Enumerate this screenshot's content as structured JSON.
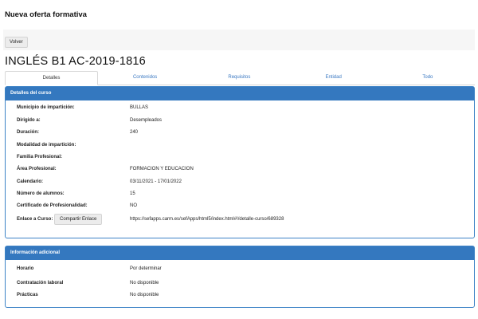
{
  "page": {
    "title": "Nueva oferta formativa",
    "back_label": "Volver",
    "course_title": "INGLÉS B1 AC-2019-1816"
  },
  "tabs": [
    {
      "label": "Detalles",
      "active": true
    },
    {
      "label": "Contenidos",
      "active": false
    },
    {
      "label": "Requisitos",
      "active": false
    },
    {
      "label": "Entidad",
      "active": false
    },
    {
      "label": "Todo",
      "active": false
    }
  ],
  "details": {
    "heading": "Detalles del curso",
    "rows": [
      {
        "label": "Municipio de impartición:",
        "value": "BULLAS"
      },
      {
        "label": "Dirigido a:",
        "value": "Desempleados"
      },
      {
        "label": "Duración:",
        "value": "240"
      },
      {
        "label": "Modalidad de impartición:",
        "value": ""
      },
      {
        "label": "Familia Profesional:",
        "value": ""
      },
      {
        "label": "Área Profesional:",
        "value": "FORMACION Y EDUCACION"
      },
      {
        "label": "Calendario:",
        "value": "03/11/2021 - 17/01/2022"
      },
      {
        "label": "Número de alumnos:",
        "value": "15"
      },
      {
        "label": "Certificado de Profesionalidad:",
        "value": "NO"
      },
      {
        "label": "Enlace a Curso:",
        "value": "https://sefapps.carm.es/sefApps/html5/index.html#!/detalle-curso/689328"
      }
    ],
    "share_label": "Compartir Enlace"
  },
  "extra": {
    "heading": "Información adicional",
    "rows": [
      {
        "label": "Horario",
        "value": "Por determinar"
      },
      {
        "label": "Contratación laboral",
        "value": "No disponible"
      },
      {
        "label": "Prácticas",
        "value": "No disponible"
      }
    ]
  },
  "colors": {
    "panel_header": "#3478bf",
    "tab_link": "#3a78c2"
  }
}
